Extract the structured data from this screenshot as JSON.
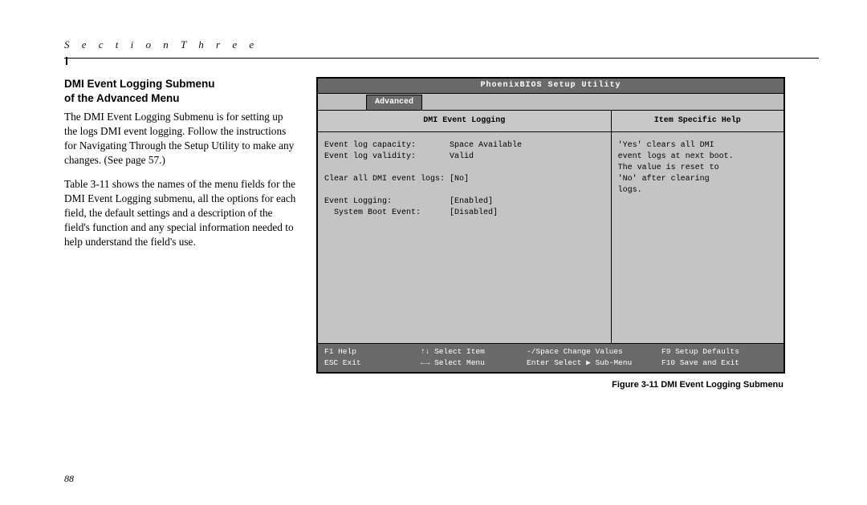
{
  "section_header": "S e c t i o n   T h r e e",
  "heading_line1": "DMI Event Logging Submenu",
  "heading_line2": "of the Advanced Menu",
  "para1": "The DMI Event Logging Submenu is for setting up the logs DMI event logging. Follow the instructions for Navigating Through the Setup Utility to make any changes. (See page 57.)",
  "para2": "Table 3-11 shows the names of the menu fields for the DMI Event Logging submenu, all the options for each field, the default settings and a description of the field's function and any special information needed to help understand the field's use.",
  "bios": {
    "title": "PhoenixBIOS Setup Utility",
    "tab": "Advanced",
    "left_header": "DMI Event Logging",
    "right_header": "Item Specific Help",
    "rows": [
      {
        "label": "Event log capacity:",
        "value": "Space Available"
      },
      {
        "label": "Event log validity:",
        "value": "Valid"
      },
      {
        "label": "",
        "value": ""
      },
      {
        "label": "Clear all DMI event logs:",
        "value": "[No]"
      },
      {
        "label": "",
        "value": ""
      },
      {
        "label": "Event Logging:",
        "value": "[Enabled]"
      },
      {
        "label": "  System Boot Event:",
        "value": "[Disabled]"
      }
    ],
    "help_lines": [
      "'Yes' clears all DMI",
      "event logs at next boot.",
      "The value is reset to",
      "'No' after clearing",
      "logs."
    ],
    "footer": {
      "r1c1": "F1  Help",
      "r1c2": "↑↓ Select Item",
      "r1c3": "-/Space Change Values",
      "r1c4": "F9  Setup Defaults",
      "r2c1": "ESC Exit",
      "r2c2": "←→ Select Menu",
      "r2c3": "Enter Select ▶ Sub-Menu",
      "r2c4": "F10 Save and Exit"
    }
  },
  "figure_caption": "Figure 3-11 DMI Event Logging Submenu",
  "page_number": "88"
}
